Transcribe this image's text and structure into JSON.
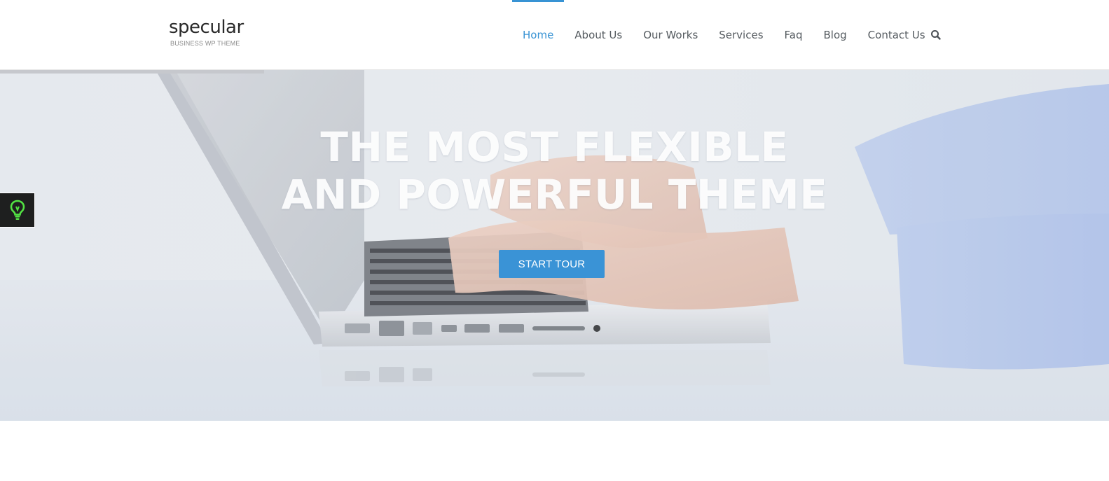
{
  "brand": {
    "name": "specular",
    "tagline": "BUSINESS WP THEME"
  },
  "nav": {
    "items": [
      {
        "label": "Home",
        "active": true
      },
      {
        "label": "About Us",
        "active": false
      },
      {
        "label": "Our Works",
        "active": false
      },
      {
        "label": "Services",
        "active": false
      },
      {
        "label": "Faq",
        "active": false
      },
      {
        "label": "Blog",
        "active": false
      },
      {
        "label": "Contact Us",
        "active": false
      }
    ],
    "search_icon": "search-icon"
  },
  "hero": {
    "title_line1": "THE MOST FLEXIBLE",
    "title_line2": "AND POWERFUL THEME",
    "button_label": "START TOUR"
  },
  "side_widget": {
    "icon": "lightbulb-icon"
  },
  "colors": {
    "accent": "#3893d4",
    "button": "#3a93d6",
    "widget_bg": "#1e1f1f",
    "widget_icon": "#52e243"
  }
}
